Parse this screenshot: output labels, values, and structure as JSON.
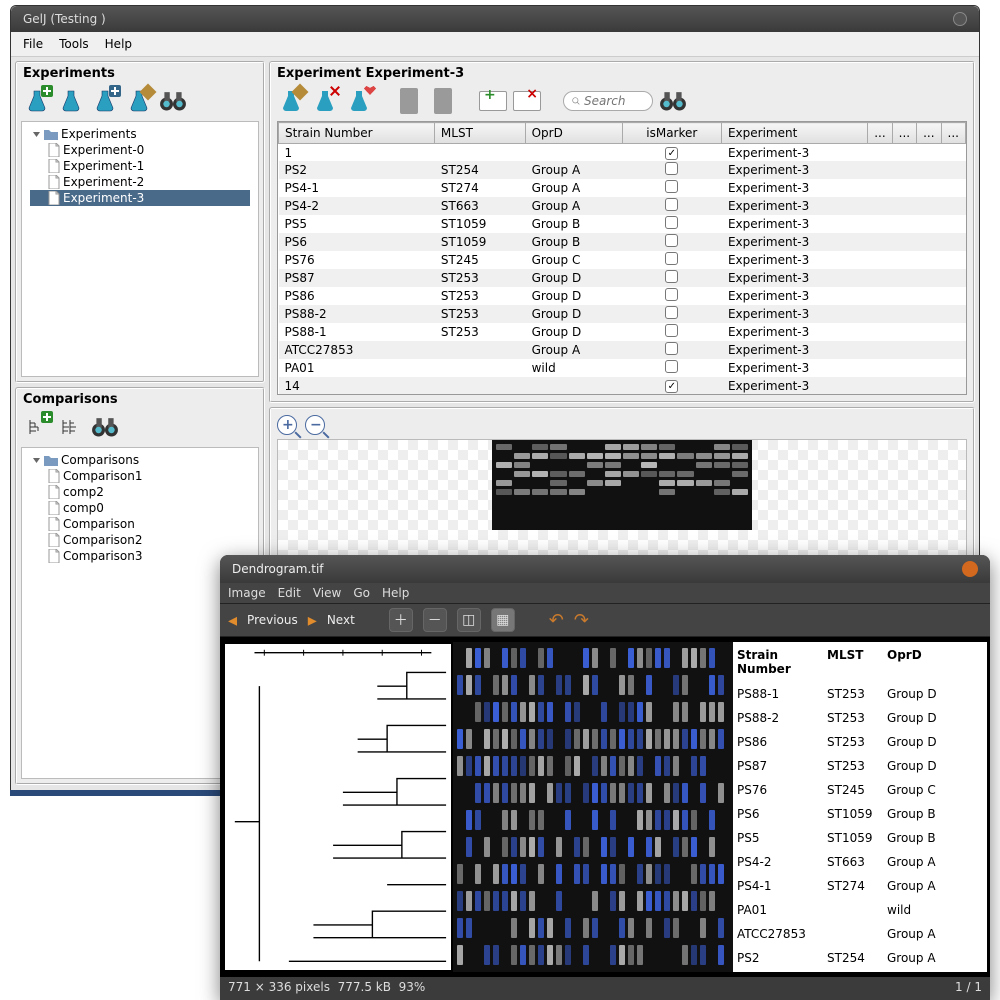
{
  "app": {
    "title": "GelJ (Testing )"
  },
  "menus": [
    "File",
    "Tools",
    "Help"
  ],
  "panels": {
    "experiments": {
      "title": "Experiments",
      "root": "Experiments",
      "items": [
        "Experiment-0",
        "Experiment-1",
        "Experiment-2",
        "Experiment-3"
      ],
      "selected": "Experiment-3"
    },
    "comparisons": {
      "title": "Comparisons",
      "root": "Comparisons",
      "items": [
        "Comparison1",
        "comp2",
        "comp0",
        "Comparison",
        "Comparison2",
        "Comparison3"
      ]
    },
    "detail": {
      "title": "Experiment Experiment-3",
      "search_placeholder": "Search"
    }
  },
  "table": {
    "columns": [
      "Strain Number",
      "MLST",
      "OprD",
      "isMarker",
      "Experiment"
    ],
    "rows": [
      {
        "strain": "1",
        "mlst": "",
        "oprd": "",
        "marker": true,
        "exp": "Experiment-3"
      },
      {
        "strain": "PS2",
        "mlst": "ST254",
        "oprd": "Group A",
        "marker": false,
        "exp": "Experiment-3"
      },
      {
        "strain": "PS4-1",
        "mlst": "ST274",
        "oprd": "Group A",
        "marker": false,
        "exp": "Experiment-3"
      },
      {
        "strain": "PS4-2",
        "mlst": "ST663",
        "oprd": "Group A",
        "marker": false,
        "exp": "Experiment-3"
      },
      {
        "strain": "PS5",
        "mlst": "ST1059",
        "oprd": "Group B",
        "marker": false,
        "exp": "Experiment-3"
      },
      {
        "strain": "PS6",
        "mlst": "ST1059",
        "oprd": "Group B",
        "marker": false,
        "exp": "Experiment-3"
      },
      {
        "strain": "PS76",
        "mlst": "ST245",
        "oprd": "Group C",
        "marker": false,
        "exp": "Experiment-3"
      },
      {
        "strain": "PS87",
        "mlst": "ST253",
        "oprd": "Group D",
        "marker": false,
        "exp": "Experiment-3"
      },
      {
        "strain": "PS86",
        "mlst": "ST253",
        "oprd": "Group D",
        "marker": false,
        "exp": "Experiment-3"
      },
      {
        "strain": "PS88-2",
        "mlst": "ST253",
        "oprd": "Group D",
        "marker": false,
        "exp": "Experiment-3"
      },
      {
        "strain": "PS88-1",
        "mlst": "ST253",
        "oprd": "Group D",
        "marker": false,
        "exp": "Experiment-3"
      },
      {
        "strain": "ATCC27853",
        "mlst": "",
        "oprd": "Group A",
        "marker": false,
        "exp": "Experiment-3"
      },
      {
        "strain": "PA01",
        "mlst": "",
        "oprd": "wild",
        "marker": false,
        "exp": "Experiment-3"
      },
      {
        "strain": "14",
        "mlst": "",
        "oprd": "",
        "marker": true,
        "exp": "Experiment-3"
      }
    ]
  },
  "viewer": {
    "title": "Dendrogram.tif",
    "menus": [
      "Image",
      "Edit",
      "View",
      "Go",
      "Help"
    ],
    "nav": {
      "prev": "Previous",
      "next": "Next"
    },
    "headers": [
      "Strain Number",
      "MLST",
      "OprD"
    ],
    "rows": [
      {
        "strain": "PS88-1",
        "mlst": "ST253",
        "oprd": "Group D"
      },
      {
        "strain": "PS88-2",
        "mlst": "ST253",
        "oprd": "Group D"
      },
      {
        "strain": "PS86",
        "mlst": "ST253",
        "oprd": "Group D"
      },
      {
        "strain": "PS87",
        "mlst": "ST253",
        "oprd": "Group D"
      },
      {
        "strain": "PS76",
        "mlst": "ST245",
        "oprd": "Group C"
      },
      {
        "strain": "PS6",
        "mlst": "ST1059",
        "oprd": "Group B"
      },
      {
        "strain": "PS5",
        "mlst": "ST1059",
        "oprd": "Group B"
      },
      {
        "strain": "PS4-2",
        "mlst": "ST663",
        "oprd": "Group A"
      },
      {
        "strain": "PS4-1",
        "mlst": "ST274",
        "oprd": "Group A"
      },
      {
        "strain": "PA01",
        "mlst": "",
        "oprd": "wild"
      },
      {
        "strain": "ATCC27853",
        "mlst": "",
        "oprd": "Group A"
      },
      {
        "strain": "PS2",
        "mlst": "ST254",
        "oprd": "Group A"
      }
    ],
    "status": {
      "dims": "771 × 336 pixels",
      "size": "777.5 kB",
      "zoom": "93%",
      "page": "1 / 1"
    }
  }
}
